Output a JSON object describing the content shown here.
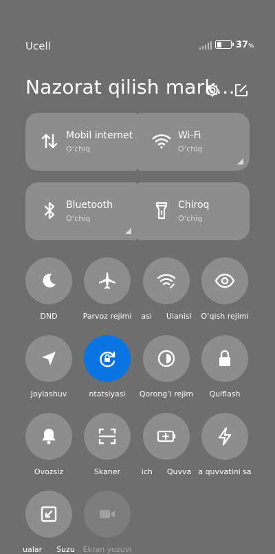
{
  "status": {
    "carrier": "Ucell",
    "battery_pct": "37",
    "battery_unit": "%"
  },
  "header": {
    "title": "Nazorat qilish mark…"
  },
  "tiles": [
    {
      "title": "Mobil internet",
      "status": "O‘chiq",
      "icon": "swap-vertical-icon"
    },
    {
      "title": "Wi-Fi",
      "status": "O‘chiq",
      "icon": "wifi-icon"
    },
    {
      "title": "Bluetooth",
      "status": "O‘chiq",
      "icon": "bluetooth-icon"
    },
    {
      "title": "Chiroq",
      "status": "O‘chiq",
      "icon": "flashlight-icon"
    }
  ],
  "toggles": [
    {
      "label": "DND",
      "icon": "moon-icon"
    },
    {
      "label": "Parvoz rejimi",
      "icon": "airplane-icon"
    },
    {
      "label": "asi      Ulanisl",
      "icon": "wifi-share-icon"
    },
    {
      "label": "O‘qish rejimi",
      "icon": "eye-icon"
    },
    {
      "label": "Joylashuv",
      "icon": "location-icon"
    },
    {
      "label": "ntatsiyasi",
      "icon": "rotation-lock-icon"
    },
    {
      "label": "Qorong‘i rejim",
      "icon": "dark-mode-icon"
    },
    {
      "label": "Qulflash",
      "icon": "lock-icon"
    },
    {
      "label": "Ovozsiz",
      "icon": "bell-icon"
    },
    {
      "label": "Skaner",
      "icon": "scanner-icon"
    },
    {
      "label": "ich      Quvva",
      "icon": "battery-saver-icon"
    },
    {
      "label": "a quvvatini sa",
      "icon": "lightning-icon"
    },
    {
      "label": "ualar      Suzu",
      "icon": "floating-window-icon"
    },
    {
      "label": "Ekran yozuvi",
      "icon": "screen-record-icon"
    }
  ],
  "colors": {
    "background": "#6e6e6e",
    "tile": "#8d8d8d",
    "accent": "#0a74e3"
  },
  "battery_level": 0.37
}
